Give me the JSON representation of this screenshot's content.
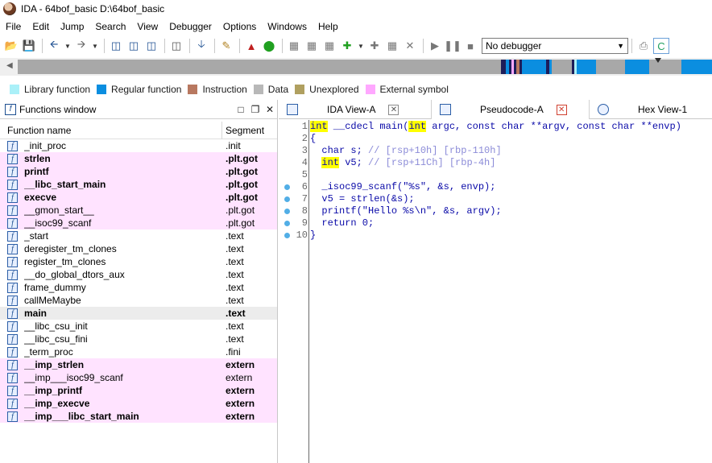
{
  "window": {
    "title": "IDA - 64bof_basic D:\\64bof_basic"
  },
  "menu": [
    "File",
    "Edit",
    "Jump",
    "Search",
    "View",
    "Debugger",
    "Options",
    "Windows",
    "Help"
  ],
  "toolbar": {
    "debugger_value": "No debugger"
  },
  "legend": [
    {
      "label": "Library function",
      "color": "#aaf0f8"
    },
    {
      "label": "Regular function",
      "color": "#0b8ee0"
    },
    {
      "label": "Instruction",
      "color": "#b87860"
    },
    {
      "label": "Data",
      "color": "#b8b8b8"
    },
    {
      "label": "Unexplored",
      "color": "#b0a060"
    },
    {
      "label": "External symbol",
      "color": "#ffa8ff"
    }
  ],
  "functions_window": {
    "title": "Functions window",
    "columns": {
      "name": "Function name",
      "segment": "Segment"
    },
    "rows": [
      {
        "name": "_init_proc",
        "segment": ".init",
        "style": "normal"
      },
      {
        "name": "strlen",
        "segment": ".plt.got",
        "style": "lib"
      },
      {
        "name": "printf",
        "segment": ".plt.got",
        "style": "lib"
      },
      {
        "name": "__libc_start_main",
        "segment": ".plt.got",
        "style": "lib"
      },
      {
        "name": "execve",
        "segment": ".plt.got",
        "style": "lib"
      },
      {
        "name": "__gmon_start__",
        "segment": ".plt.got",
        "style": "lib-light"
      },
      {
        "name": "__isoc99_scanf",
        "segment": ".plt.got",
        "style": "lib-light"
      },
      {
        "name": "_start",
        "segment": ".text",
        "style": "normal"
      },
      {
        "name": "deregister_tm_clones",
        "segment": ".text",
        "style": "normal"
      },
      {
        "name": "register_tm_clones",
        "segment": ".text",
        "style": "normal"
      },
      {
        "name": "__do_global_dtors_aux",
        "segment": ".text",
        "style": "normal"
      },
      {
        "name": "frame_dummy",
        "segment": ".text",
        "style": "normal"
      },
      {
        "name": "callMeMaybe",
        "segment": ".text",
        "style": "normal"
      },
      {
        "name": "main",
        "segment": ".text",
        "style": "selected"
      },
      {
        "name": "__libc_csu_init",
        "segment": ".text",
        "style": "normal"
      },
      {
        "name": "__libc_csu_fini",
        "segment": ".text",
        "style": "normal"
      },
      {
        "name": "_term_proc",
        "segment": ".fini",
        "style": "normal"
      },
      {
        "name": "__imp_strlen",
        "segment": "extern",
        "style": "lib"
      },
      {
        "name": "__imp___isoc99_scanf",
        "segment": "extern",
        "style": "lib-light"
      },
      {
        "name": "__imp_printf",
        "segment": "extern",
        "style": "lib"
      },
      {
        "name": "__imp_execve",
        "segment": "extern",
        "style": "lib"
      },
      {
        "name": "__imp___libc_start_main",
        "segment": "extern",
        "style": "lib"
      }
    ]
  },
  "tabs": [
    {
      "label": "IDA View-A",
      "active": false
    },
    {
      "label": "Pseudocode-A",
      "active": true
    },
    {
      "label": "Hex View-1",
      "active": false
    }
  ],
  "pseudocode": {
    "lines": [
      {
        "num": "1",
        "dot": false,
        "parts": [
          [
            "int",
            "kw"
          ],
          [
            " __cdecl main(",
            ""
          ],
          [
            "int",
            "kw"
          ],
          [
            " argc, const char **argv, const char **envp)",
            ""
          ]
        ]
      },
      {
        "num": "2",
        "dot": false,
        "parts": [
          [
            "{",
            ""
          ]
        ]
      },
      {
        "num": "3",
        "dot": false,
        "parts": [
          [
            "  char s; ",
            ""
          ],
          [
            "// [rsp+10h] [rbp-110h]",
            "cmt"
          ]
        ]
      },
      {
        "num": "4",
        "dot": false,
        "parts": [
          [
            "  ",
            ""
          ],
          [
            "int",
            "kw"
          ],
          [
            " v5; ",
            ""
          ],
          [
            "// [rsp+11Ch] [rbp-4h]",
            "cmt"
          ]
        ]
      },
      {
        "num": "5",
        "dot": false,
        "parts": [
          [
            "",
            ""
          ]
        ]
      },
      {
        "num": "6",
        "dot": true,
        "parts": [
          [
            "  _isoc99_scanf(\"%s\", &s, envp);",
            ""
          ]
        ]
      },
      {
        "num": "7",
        "dot": true,
        "parts": [
          [
            "  v5 = strlen(&s);",
            ""
          ]
        ]
      },
      {
        "num": "8",
        "dot": true,
        "parts": [
          [
            "  printf(\"Hello %s\\n\", &s, argv);",
            ""
          ]
        ]
      },
      {
        "num": "9",
        "dot": true,
        "parts": [
          [
            "  return 0;",
            ""
          ]
        ]
      },
      {
        "num": "10",
        "dot": true,
        "parts": [
          [
            "}",
            ""
          ]
        ]
      }
    ]
  }
}
